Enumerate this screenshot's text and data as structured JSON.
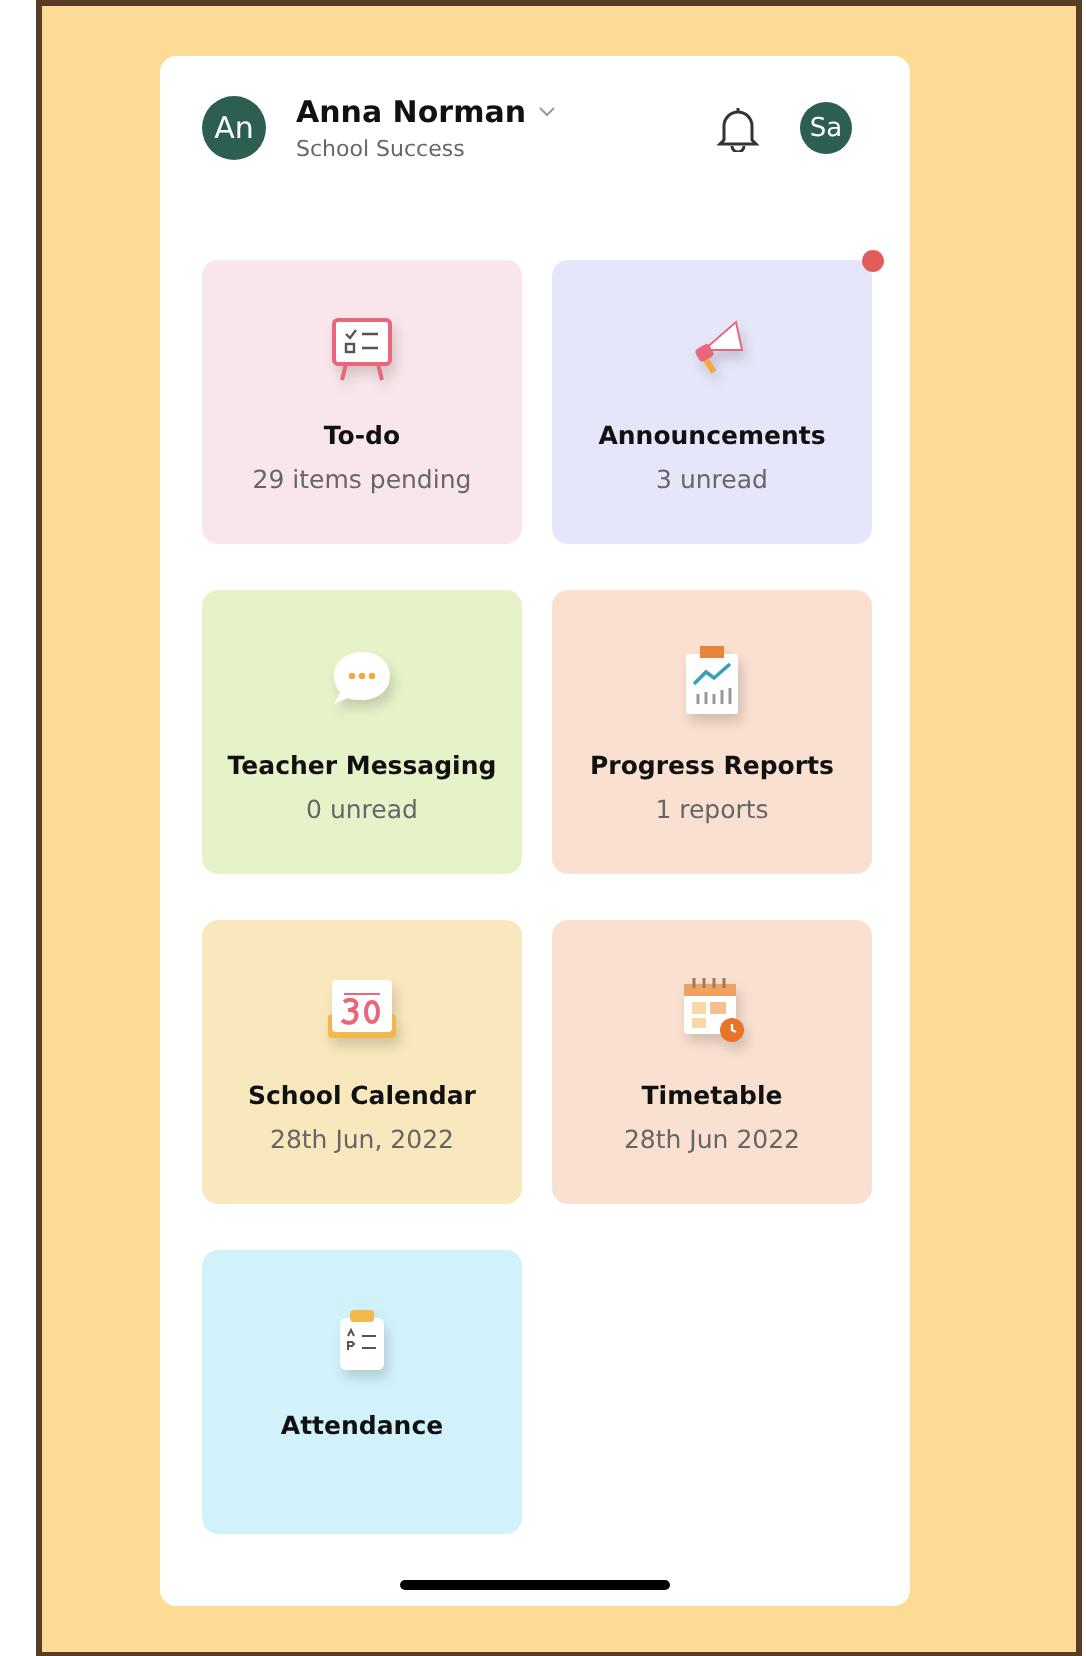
{
  "header": {
    "avatar": "An",
    "name": "Anna Norman",
    "school": "School Success",
    "profile": "Sa"
  },
  "tiles": [
    {
      "kind": "todo",
      "title": "To-do",
      "subtitle": "29 items pending",
      "color": "#f9e6ea",
      "unread_dot": false
    },
    {
      "kind": "announcements",
      "title": "Announcements",
      "subtitle": "3 unread",
      "color": "#e6e6fa",
      "unread_dot": true
    },
    {
      "kind": "messaging",
      "title": "Teacher Messaging",
      "subtitle": "0 unread",
      "color": "#e6f3c9",
      "unread_dot": false
    },
    {
      "kind": "reports",
      "title": "Progress Reports",
      "subtitle": "1 reports",
      "color": "#f9e0d0",
      "unread_dot": false
    },
    {
      "kind": "calendar",
      "title": "School Calendar",
      "subtitle": "28th Jun, 2022",
      "color": "#f9e8bd",
      "unread_dot": false
    },
    {
      "kind": "timetable",
      "title": "Timetable",
      "subtitle": "28th Jun 2022",
      "color": "#f9e0d0",
      "unread_dot": false
    },
    {
      "kind": "attendance",
      "title": "Attendance",
      "color": "#d2f2fb",
      "unread_dot": false
    }
  ]
}
